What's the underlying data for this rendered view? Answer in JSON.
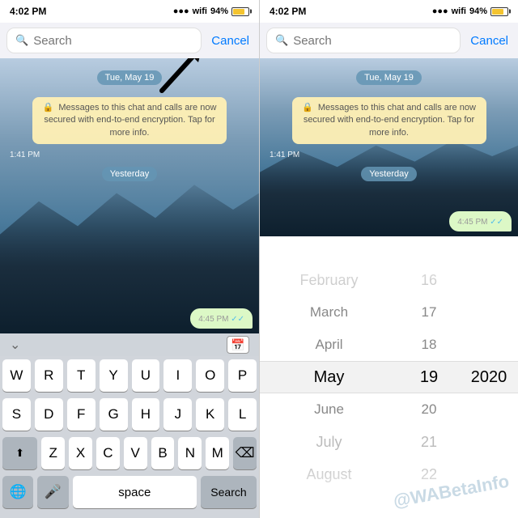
{
  "panels": {
    "left": {
      "status": {
        "time": "4:02 PM",
        "wifi": "⊙",
        "battery_pct": "94%"
      },
      "search": {
        "placeholder": "Search",
        "cancel": "Cancel"
      },
      "chat": {
        "date_header": "Tue, May 19",
        "system_msg": "Messages to this chat and calls are now secured with end-to-end encryption. Tap for more info.",
        "timestamp1": "1:41 PM",
        "yesterday": "Yesterday",
        "msg_time": "4:45 PM"
      },
      "keyboard": {
        "row1": [
          "W",
          "R",
          "T",
          "Y",
          "U",
          "I",
          "O",
          "P"
        ],
        "row2": [
          "S",
          "D",
          "F",
          "G",
          "H",
          "J",
          "K",
          "L"
        ],
        "row3": [
          "Z",
          "X",
          "C",
          "V",
          "B",
          "N",
          "M"
        ],
        "space_label": "space",
        "search_label": "Search",
        "delete": "⌫"
      }
    },
    "right": {
      "status": {
        "time": "4:02 PM",
        "wifi": "⊙",
        "battery_pct": "94%"
      },
      "search": {
        "placeholder": "Search",
        "cancel": "Cancel"
      },
      "chat": {
        "date_header": "Tue, May 19",
        "system_msg": "Messages to this chat and calls are now secured with end-to-end encryption. Tap for more info.",
        "timestamp1": "1:41 PM",
        "yesterday": "Yesterday",
        "msg_time": "4:45 PM"
      },
      "picker": {
        "months": [
          "February",
          "March",
          "April",
          "May",
          "June",
          "July",
          "August"
        ],
        "selected_month": "May",
        "days": [
          16,
          17,
          18,
          19,
          20,
          21,
          22
        ],
        "selected_day": 19,
        "years": [
          "2020"
        ],
        "selected_year": "2020"
      }
    }
  },
  "watermark": "@WABetaInfo"
}
